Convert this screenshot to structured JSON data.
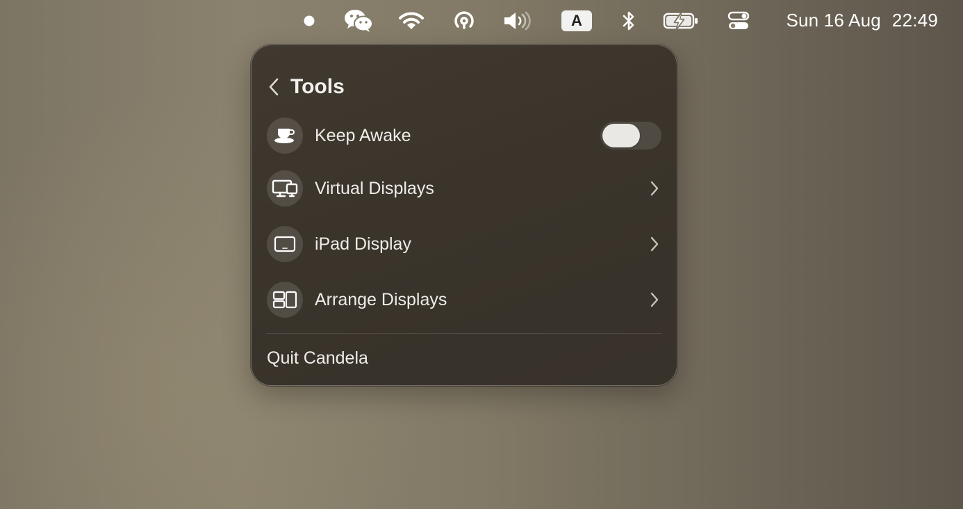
{
  "menubar": {
    "icons": [
      "dot-status-icon",
      "wechat-icon",
      "wifi-icon",
      "airdrop-icon",
      "volume-icon",
      "input-source-icon",
      "bluetooth-icon",
      "battery-charging-icon",
      "control-center-icon"
    ],
    "input_source_label": "A",
    "date": "Sun 16 Aug",
    "time": "22:49"
  },
  "panel": {
    "title": "Tools",
    "items": [
      {
        "label": "Keep Awake",
        "icon": "cup-icon",
        "control": "toggle",
        "toggle_on": false
      },
      {
        "label": "Virtual Displays",
        "icon": "displays-icon",
        "control": "chevron"
      },
      {
        "label": "iPad Display",
        "icon": "ipad-icon",
        "control": "chevron"
      },
      {
        "label": "Arrange Displays",
        "icon": "arrange-displays-icon",
        "control": "chevron"
      }
    ],
    "quit_label": "Quit Candela"
  },
  "colors": {
    "panel_background": "#3a342b",
    "desktop_background": "#827a66",
    "text": "#eeede9"
  }
}
